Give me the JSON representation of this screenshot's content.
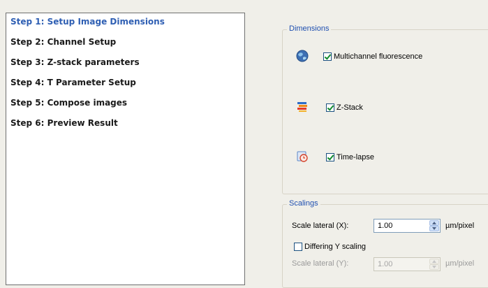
{
  "steps": [
    {
      "label": "Step 1: Setup Image Dimensions",
      "active": true
    },
    {
      "label": "Step 2: Channel Setup"
    },
    {
      "label": "Step 3: Z-stack parameters"
    },
    {
      "label": "Step 4: T Parameter Setup"
    },
    {
      "label": "Step 5: Compose images"
    },
    {
      "label": "Step 6: Preview Result"
    }
  ],
  "dimensions": {
    "title": "Dimensions",
    "options": [
      {
        "label": "Multichannel fluorescence",
        "checked": true,
        "icon": "multichannel-icon"
      },
      {
        "label": "Z-Stack",
        "checked": true,
        "icon": "z-stack-icon"
      },
      {
        "label": "Time-lapse",
        "checked": true,
        "icon": "time-lapse-icon"
      }
    ]
  },
  "scalings": {
    "title": "Scalings",
    "scale_x": {
      "label": "Scale lateral (X):",
      "value": "1.00",
      "unit": "µm/pixel"
    },
    "differing_y": {
      "label": "Differing Y scaling",
      "checked": false
    },
    "scale_y": {
      "label": "Scale lateral (Y):",
      "value": "1.00",
      "unit": "µm/pixel",
      "disabled": true
    }
  },
  "colors": {
    "active_step": "#2f5fb3",
    "legend": "#1f4fb0",
    "background": "#f0efe9"
  }
}
